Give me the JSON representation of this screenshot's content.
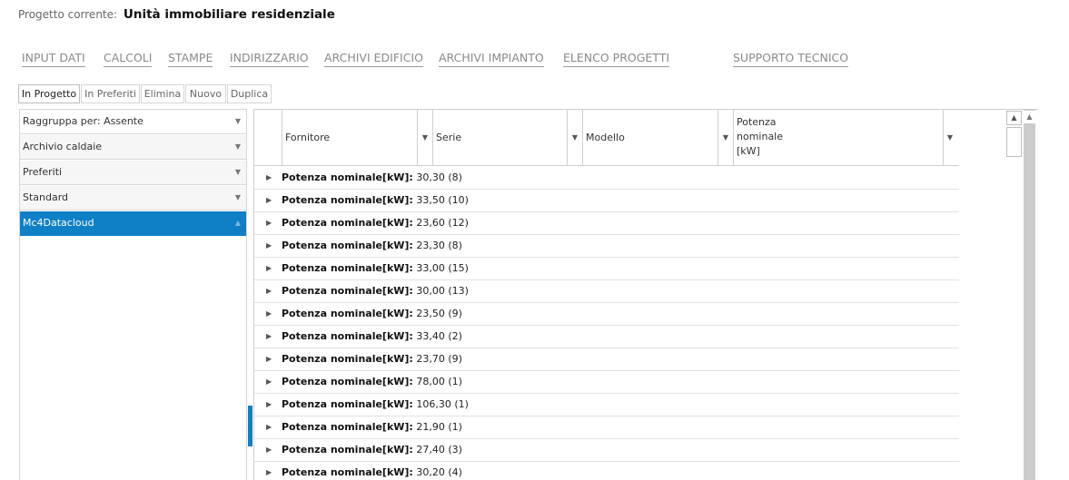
{
  "project": {
    "label": "Progetto corrente:",
    "name": "Unità immobiliare residenziale"
  },
  "menu": [
    "INPUT DATI",
    "CALCOLI",
    "STAMPE",
    "INDIRIZZARIO",
    "ARCHIVI EDIFICIO",
    "ARCHIVI IMPIANTO",
    "ELENCO PROGETTI",
    "SUPPORTO TECNICO"
  ],
  "toolbar": [
    "In Progetto",
    "In Preferiti",
    "Elimina",
    "Nuovo",
    "Duplica"
  ],
  "left_panel": {
    "group_by": "Raggruppa per:  Assente",
    "items": [
      "Archivio caldaie",
      "Preferiti",
      "Standard",
      "Mc4Datacloud"
    ],
    "selected": "Mc4Datacloud"
  },
  "grid": {
    "columns": [
      "Fornitore",
      "Serie",
      "Modello",
      "Potenza\nnominale\n[kW]"
    ],
    "group_label": "Potenza nominale[kW]:",
    "groups": [
      "30,30 (8)",
      "33,50 (10)",
      "23,60 (12)",
      "23,30 (8)",
      "33,00 (15)",
      "30,00 (13)",
      "23,50 (9)",
      "33,40 (2)",
      "23,70 (9)",
      "78,00 (1)",
      "106,30 (1)",
      "21,90 (1)",
      "27,40 (3)",
      "30,20 (4)"
    ]
  },
  "icons": {
    "expand": "triangle-right-icon",
    "filter": "triangle-down-icon",
    "collapse": "triangle-up-icon"
  },
  "colors": {
    "selection": "#0f80c6",
    "menu_text": "#8a8a8a"
  }
}
